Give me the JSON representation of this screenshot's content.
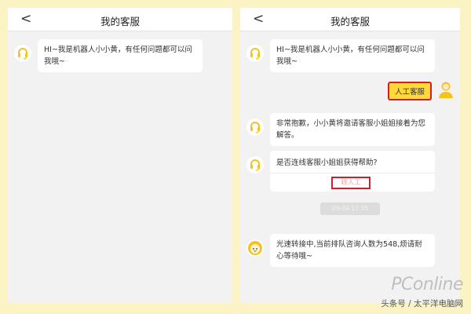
{
  "left": {
    "header": {
      "back": "<",
      "title": "我的客服"
    },
    "messages": [
      {
        "text": "HI~我是机器人小小黄，有任何问题都可以问我哦~"
      }
    ]
  },
  "right": {
    "header": {
      "back": "<",
      "title": "我的客服"
    },
    "messages": [
      {
        "text": "HI~我是机器人小小黄，有任何问题都可以问我哦~"
      },
      {
        "text": "非常抱歉，小小黄将邀请客服小姐姐接着为您解答。"
      },
      {
        "text": "是否连线客服小姐姐获得帮助?"
      },
      {
        "text": "光速转接中,当前排队咨询人数为548,烦请耐心等待哦~"
      }
    ],
    "user_message": "人工客服",
    "option_label": "转人工",
    "timestamp": "09-04 17:35"
  },
  "watermark": {
    "brand": "PConline",
    "sub": "头条号 / 太平洋电脑网"
  },
  "colors": {
    "background": "#fbf3c3",
    "bubble_user": "#ffd83a",
    "highlight": "#d11f2a",
    "icon": "#f7c21b"
  }
}
